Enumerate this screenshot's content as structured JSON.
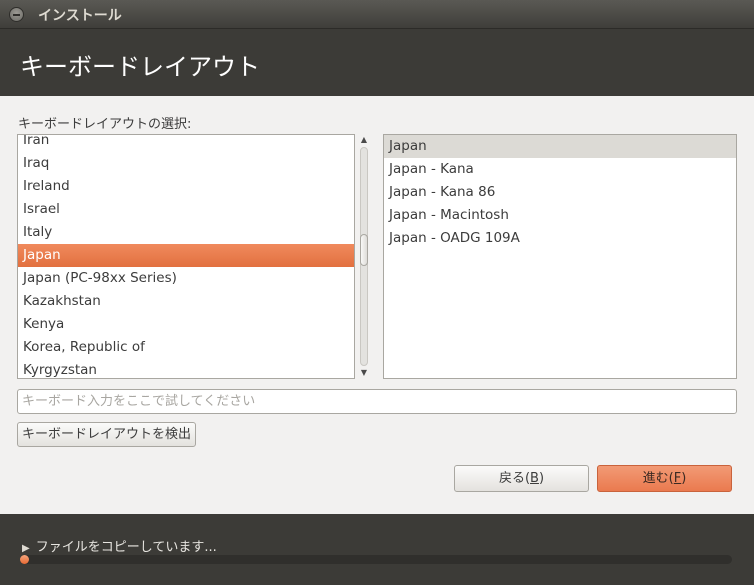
{
  "window": {
    "title": "インストール"
  },
  "header": {
    "title": "キーボードレイアウト"
  },
  "main": {
    "section_label": "キーボードレイアウトの選択:",
    "layouts": [
      {
        "label": "Iran",
        "selected": false
      },
      {
        "label": "Iraq",
        "selected": false
      },
      {
        "label": "Ireland",
        "selected": false
      },
      {
        "label": "Israel",
        "selected": false
      },
      {
        "label": "Italy",
        "selected": false
      },
      {
        "label": "Japan",
        "selected": true
      },
      {
        "label": "Japan (PC-98xx Series)",
        "selected": false
      },
      {
        "label": "Kazakhstan",
        "selected": false
      },
      {
        "label": "Kenya",
        "selected": false
      },
      {
        "label": "Korea, Republic of",
        "selected": false
      },
      {
        "label": "Kyrgyzstan",
        "selected": false
      }
    ],
    "variants": [
      {
        "label": "Japan",
        "selected": true
      },
      {
        "label": "Japan - Kana",
        "selected": false
      },
      {
        "label": "Japan - Kana 86",
        "selected": false
      },
      {
        "label": "Japan - Macintosh",
        "selected": false
      },
      {
        "label": "Japan - OADG 109A",
        "selected": false
      }
    ],
    "test_input": {
      "value": "",
      "placeholder": "キーボード入力をここで試してください"
    },
    "detect_button": "キーボードレイアウトを検出",
    "back_button": {
      "label": "戻る(",
      "mnemonic": "B",
      "suffix": ")"
    },
    "next_button": {
      "label": "進む(",
      "mnemonic": "F",
      "suffix": ")"
    }
  },
  "footer": {
    "status": "ファイルをコピーしています...",
    "progress": 0.01
  },
  "colors": {
    "accent": "#e86a34",
    "header_bg": "#3c3b37",
    "selection": "#e2703f"
  }
}
